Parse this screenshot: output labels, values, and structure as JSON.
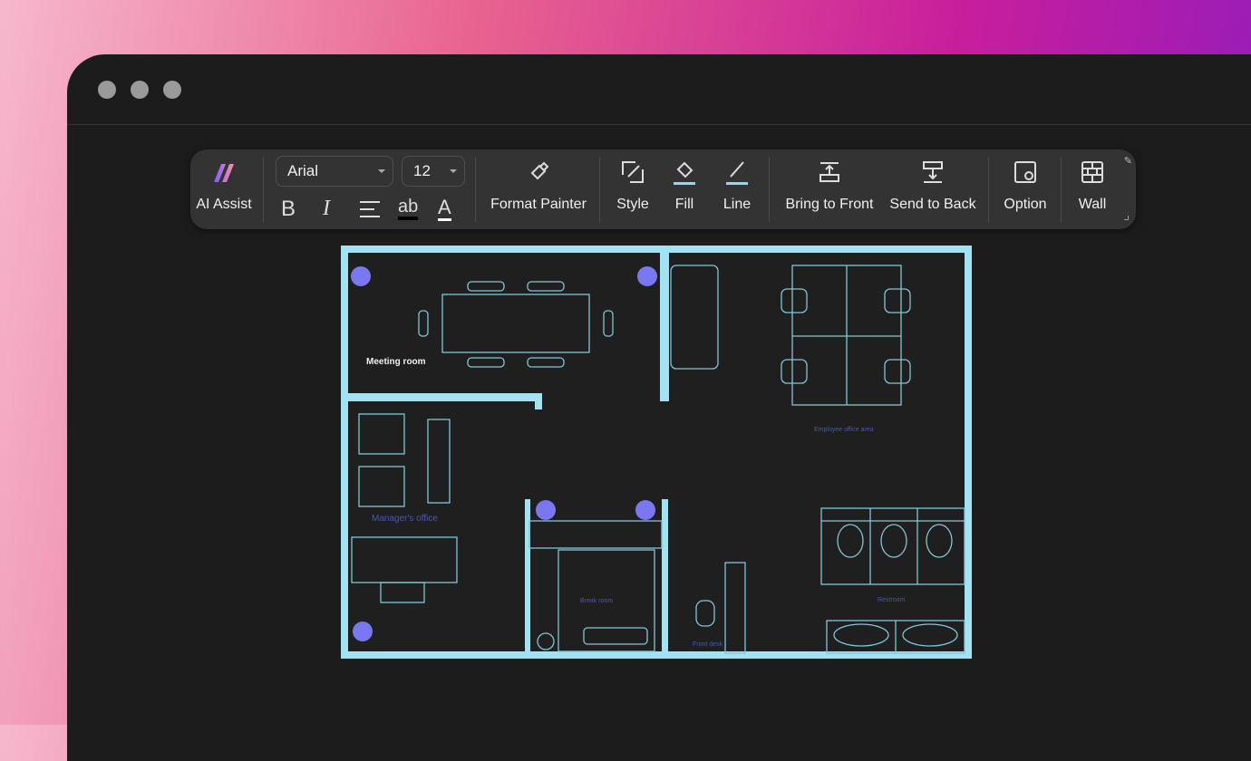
{
  "window": {
    "controls": [
      "close",
      "minimize",
      "maximize"
    ]
  },
  "toolbar": {
    "ai_assist": "AI Assist",
    "font": "Arial",
    "size": "12",
    "format_painter": "Format Painter",
    "style": "Style",
    "fill": "Fill",
    "line": "Line",
    "bring_front": "Bring to Front",
    "send_back": "Send to Back",
    "option": "Option",
    "wall": "Wall",
    "accent": "#8fdcf0"
  },
  "plan": {
    "rooms": {
      "meeting": "Meeting room",
      "employee": "Employee office area",
      "manager": "Manager's office",
      "break": "Break room",
      "front": "Front desk",
      "restroom": "Restroom"
    },
    "wall_color": "#a3e2f2",
    "line_color": "#7fc7d8"
  }
}
